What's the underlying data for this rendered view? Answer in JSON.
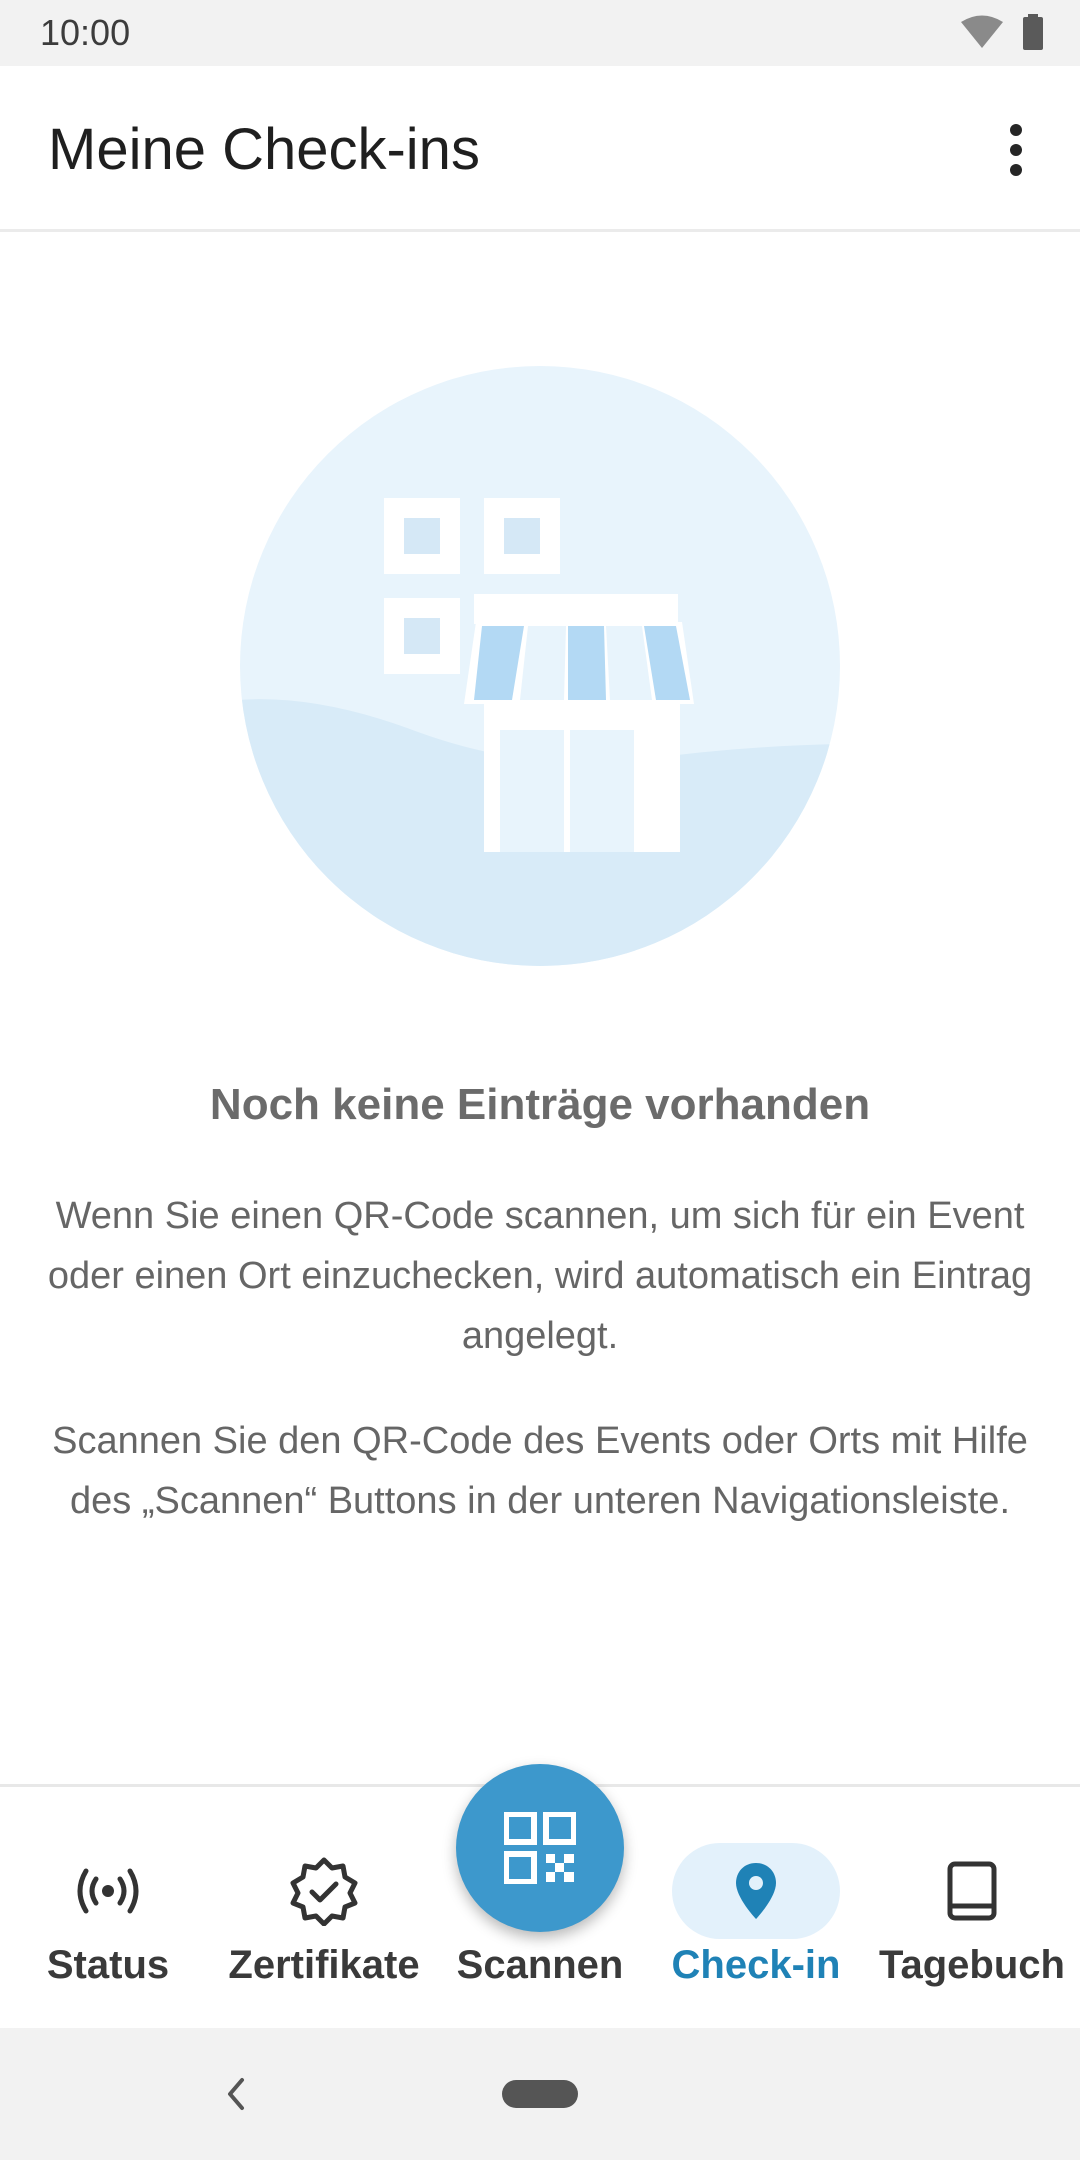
{
  "status_bar": {
    "time": "10:00",
    "icons": [
      "wifi-icon",
      "battery-icon"
    ]
  },
  "app_bar": {
    "title": "Meine Check-ins",
    "menu_icon": "more-vert-icon"
  },
  "empty_state": {
    "illustration": "storefront-qr-illustration",
    "title": "Noch keine Einträge vorhanden",
    "paragraph1": "Wenn Sie einen QR-Code scannen, um sich für ein Event oder einen Ort einzuchecken, wird automatisch ein Eintrag angelegt.",
    "paragraph2": "Scannen Sie den QR-Code des Events oder Orts mit Hilfe des „Scannen“ Buttons in der unteren Navigationsleiste."
  },
  "bottom_nav": {
    "items": [
      {
        "label": "Status",
        "icon": "broadcast-icon",
        "active": false
      },
      {
        "label": "Zertifikate",
        "icon": "verified-badge-icon",
        "active": false
      },
      {
        "label": "Scannen",
        "icon": "qr-code-icon",
        "active": false
      },
      {
        "label": "Check-in",
        "icon": "location-pin-icon",
        "active": true
      },
      {
        "label": "Tagebuch",
        "icon": "book-icon",
        "active": false
      }
    ]
  },
  "colors": {
    "accent": "#1f82b6",
    "fab": "#3d98cc",
    "active_pill": "#e3f1fb",
    "illustration_bg": "#e8f4fc"
  }
}
